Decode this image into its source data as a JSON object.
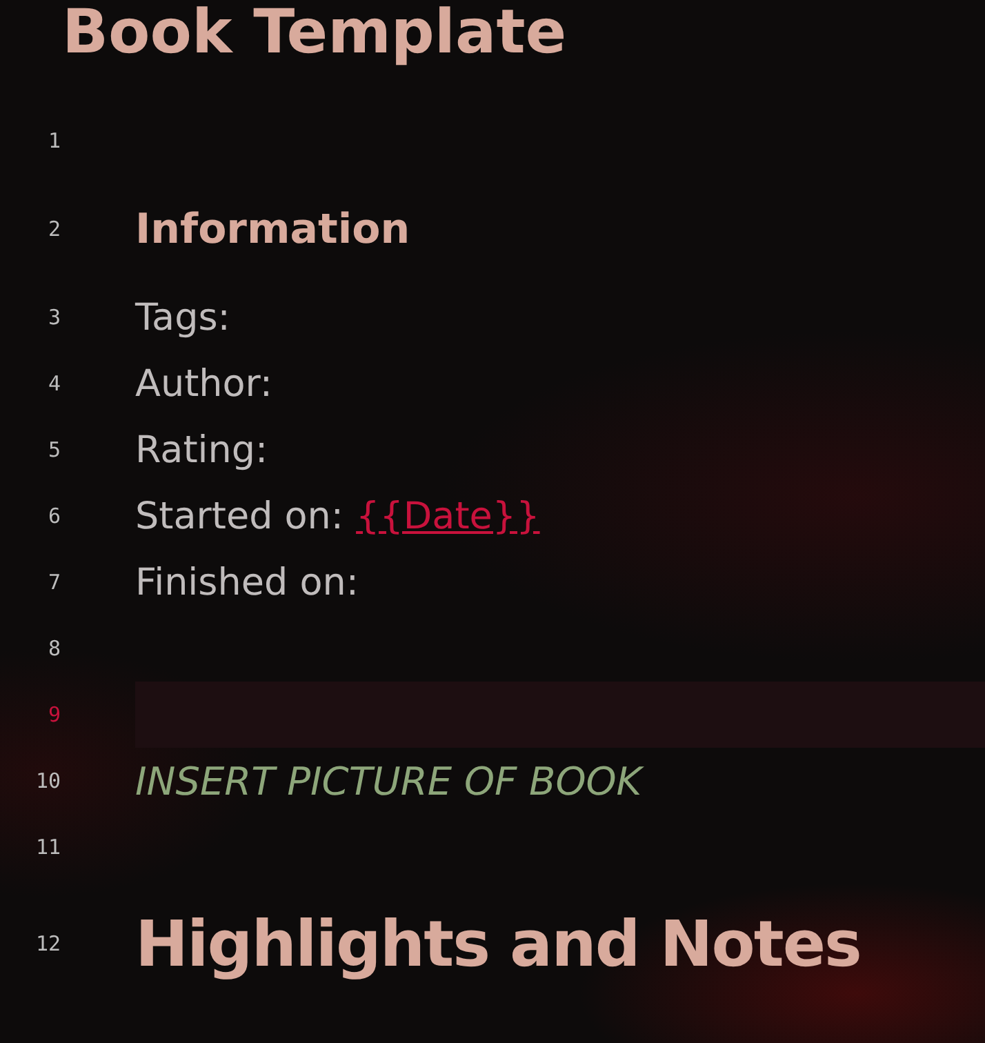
{
  "title": "Book Template",
  "lines": [
    {
      "number": "1",
      "kind": "blank",
      "active": false
    },
    {
      "number": "2",
      "kind": "heading3",
      "text": "Information",
      "active": false
    },
    {
      "number": "3",
      "kind": "text",
      "text": "Tags:",
      "active": false
    },
    {
      "number": "4",
      "kind": "text",
      "text": "Author:",
      "active": false
    },
    {
      "number": "5",
      "kind": "text",
      "text": "Rating:",
      "active": false
    },
    {
      "number": "6",
      "kind": "text",
      "text": "Started on:",
      "link": "{{Date}}",
      "active": false
    },
    {
      "number": "7",
      "kind": "text",
      "text": "Finished on:",
      "active": false
    },
    {
      "number": "8",
      "kind": "blank",
      "active": false
    },
    {
      "number": "9",
      "kind": "blank",
      "active": true
    },
    {
      "number": "10",
      "kind": "comment",
      "text": "INSERT PICTURE OF BOOK",
      "active": false
    },
    {
      "number": "11",
      "kind": "blank",
      "active": false
    },
    {
      "number": "12",
      "kind": "heading1",
      "text": "Highlights and Notes",
      "active": false
    }
  ]
}
